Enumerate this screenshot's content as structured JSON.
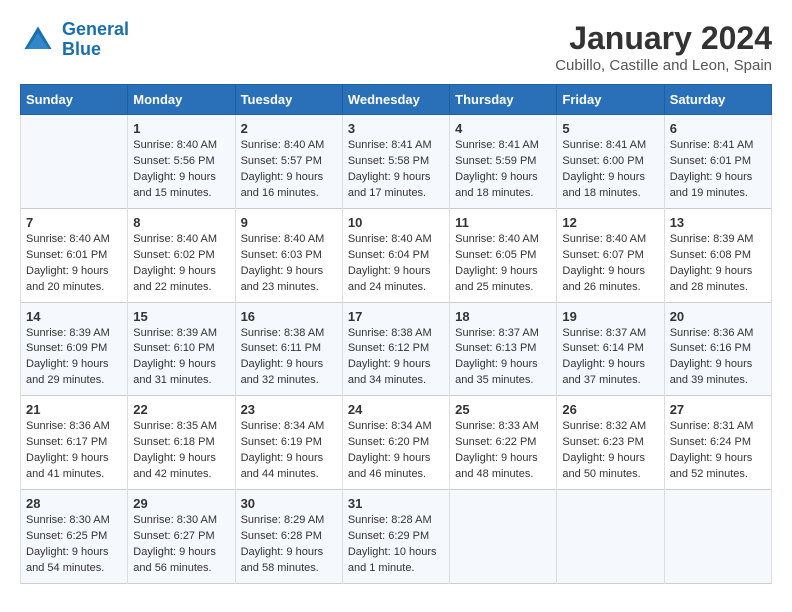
{
  "logo": {
    "line1": "General",
    "line2": "Blue"
  },
  "title": "January 2024",
  "location": "Cubillo, Castille and Leon, Spain",
  "headers": [
    "Sunday",
    "Monday",
    "Tuesday",
    "Wednesday",
    "Thursday",
    "Friday",
    "Saturday"
  ],
  "rows": [
    [
      {
        "day": "",
        "content": ""
      },
      {
        "day": "1",
        "content": "Sunrise: 8:40 AM\nSunset: 5:56 PM\nDaylight: 9 hours\nand 15 minutes."
      },
      {
        "day": "2",
        "content": "Sunrise: 8:40 AM\nSunset: 5:57 PM\nDaylight: 9 hours\nand 16 minutes."
      },
      {
        "day": "3",
        "content": "Sunrise: 8:41 AM\nSunset: 5:58 PM\nDaylight: 9 hours\nand 17 minutes."
      },
      {
        "day": "4",
        "content": "Sunrise: 8:41 AM\nSunset: 5:59 PM\nDaylight: 9 hours\nand 18 minutes."
      },
      {
        "day": "5",
        "content": "Sunrise: 8:41 AM\nSunset: 6:00 PM\nDaylight: 9 hours\nand 18 minutes."
      },
      {
        "day": "6",
        "content": "Sunrise: 8:41 AM\nSunset: 6:01 PM\nDaylight: 9 hours\nand 19 minutes."
      }
    ],
    [
      {
        "day": "7",
        "content": "Sunrise: 8:40 AM\nSunset: 6:01 PM\nDaylight: 9 hours\nand 20 minutes."
      },
      {
        "day": "8",
        "content": "Sunrise: 8:40 AM\nSunset: 6:02 PM\nDaylight: 9 hours\nand 22 minutes."
      },
      {
        "day": "9",
        "content": "Sunrise: 8:40 AM\nSunset: 6:03 PM\nDaylight: 9 hours\nand 23 minutes."
      },
      {
        "day": "10",
        "content": "Sunrise: 8:40 AM\nSunset: 6:04 PM\nDaylight: 9 hours\nand 24 minutes."
      },
      {
        "day": "11",
        "content": "Sunrise: 8:40 AM\nSunset: 6:05 PM\nDaylight: 9 hours\nand 25 minutes."
      },
      {
        "day": "12",
        "content": "Sunrise: 8:40 AM\nSunset: 6:07 PM\nDaylight: 9 hours\nand 26 minutes."
      },
      {
        "day": "13",
        "content": "Sunrise: 8:39 AM\nSunset: 6:08 PM\nDaylight: 9 hours\nand 28 minutes."
      }
    ],
    [
      {
        "day": "14",
        "content": "Sunrise: 8:39 AM\nSunset: 6:09 PM\nDaylight: 9 hours\nand 29 minutes."
      },
      {
        "day": "15",
        "content": "Sunrise: 8:39 AM\nSunset: 6:10 PM\nDaylight: 9 hours\nand 31 minutes."
      },
      {
        "day": "16",
        "content": "Sunrise: 8:38 AM\nSunset: 6:11 PM\nDaylight: 9 hours\nand 32 minutes."
      },
      {
        "day": "17",
        "content": "Sunrise: 8:38 AM\nSunset: 6:12 PM\nDaylight: 9 hours\nand 34 minutes."
      },
      {
        "day": "18",
        "content": "Sunrise: 8:37 AM\nSunset: 6:13 PM\nDaylight: 9 hours\nand 35 minutes."
      },
      {
        "day": "19",
        "content": "Sunrise: 8:37 AM\nSunset: 6:14 PM\nDaylight: 9 hours\nand 37 minutes."
      },
      {
        "day": "20",
        "content": "Sunrise: 8:36 AM\nSunset: 6:16 PM\nDaylight: 9 hours\nand 39 minutes."
      }
    ],
    [
      {
        "day": "21",
        "content": "Sunrise: 8:36 AM\nSunset: 6:17 PM\nDaylight: 9 hours\nand 41 minutes."
      },
      {
        "day": "22",
        "content": "Sunrise: 8:35 AM\nSunset: 6:18 PM\nDaylight: 9 hours\nand 42 minutes."
      },
      {
        "day": "23",
        "content": "Sunrise: 8:34 AM\nSunset: 6:19 PM\nDaylight: 9 hours\nand 44 minutes."
      },
      {
        "day": "24",
        "content": "Sunrise: 8:34 AM\nSunset: 6:20 PM\nDaylight: 9 hours\nand 46 minutes."
      },
      {
        "day": "25",
        "content": "Sunrise: 8:33 AM\nSunset: 6:22 PM\nDaylight: 9 hours\nand 48 minutes."
      },
      {
        "day": "26",
        "content": "Sunrise: 8:32 AM\nSunset: 6:23 PM\nDaylight: 9 hours\nand 50 minutes."
      },
      {
        "day": "27",
        "content": "Sunrise: 8:31 AM\nSunset: 6:24 PM\nDaylight: 9 hours\nand 52 minutes."
      }
    ],
    [
      {
        "day": "28",
        "content": "Sunrise: 8:30 AM\nSunset: 6:25 PM\nDaylight: 9 hours\nand 54 minutes."
      },
      {
        "day": "29",
        "content": "Sunrise: 8:30 AM\nSunset: 6:27 PM\nDaylight: 9 hours\nand 56 minutes."
      },
      {
        "day": "30",
        "content": "Sunrise: 8:29 AM\nSunset: 6:28 PM\nDaylight: 9 hours\nand 58 minutes."
      },
      {
        "day": "31",
        "content": "Sunrise: 8:28 AM\nSunset: 6:29 PM\nDaylight: 10 hours\nand 1 minute."
      },
      {
        "day": "",
        "content": ""
      },
      {
        "day": "",
        "content": ""
      },
      {
        "day": "",
        "content": ""
      }
    ]
  ]
}
